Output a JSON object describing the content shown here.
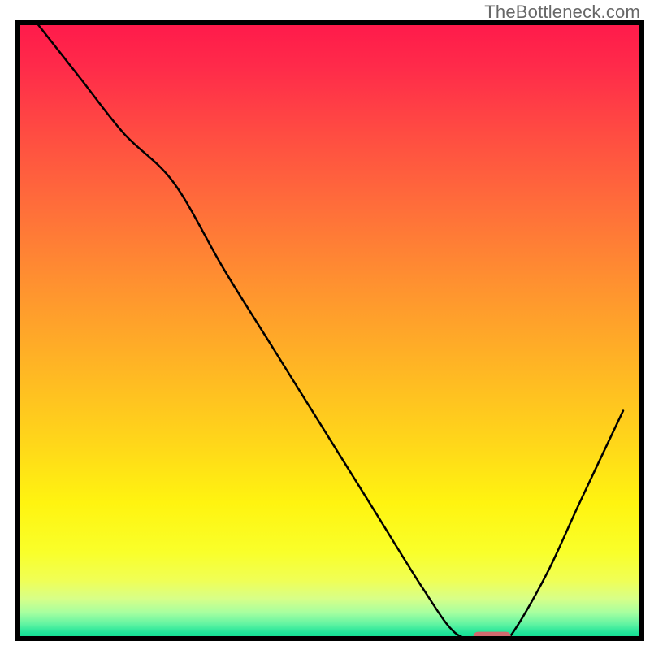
{
  "watermark": "TheBottleneck.com",
  "chart_data": {
    "type": "line",
    "title": "",
    "xlabel": "",
    "ylabel": "",
    "xlim": [
      0,
      100
    ],
    "ylim": [
      0,
      100
    ],
    "series": [
      {
        "name": "curve",
        "x": [
          3,
          10,
          17,
          25,
          33,
          41,
          49,
          57,
          65,
          70,
          74,
          78,
          80,
          85,
          90,
          97
        ],
        "y": [
          100,
          91,
          82,
          74,
          60,
          47,
          34,
          21,
          8,
          1,
          0,
          0,
          2,
          11,
          22,
          37
        ]
      }
    ],
    "marker": {
      "x_center": 76,
      "y_center": 0.4,
      "width": 6,
      "height": 1.4,
      "color": "#d16a6f"
    },
    "gradient_stops": [
      {
        "offset": 0.0,
        "color": "#ff1a4b"
      },
      {
        "offset": 0.07,
        "color": "#ff2a4a"
      },
      {
        "offset": 0.18,
        "color": "#ff4c42"
      },
      {
        "offset": 0.3,
        "color": "#ff6e3a"
      },
      {
        "offset": 0.42,
        "color": "#ff9030"
      },
      {
        "offset": 0.55,
        "color": "#ffb325"
      },
      {
        "offset": 0.68,
        "color": "#ffd61a"
      },
      {
        "offset": 0.78,
        "color": "#fff410"
      },
      {
        "offset": 0.86,
        "color": "#f9ff2a"
      },
      {
        "offset": 0.905,
        "color": "#f0ff55"
      },
      {
        "offset": 0.935,
        "color": "#d8ff88"
      },
      {
        "offset": 0.958,
        "color": "#a6ffa0"
      },
      {
        "offset": 0.976,
        "color": "#63f4a2"
      },
      {
        "offset": 0.99,
        "color": "#22e59a"
      },
      {
        "offset": 1.0,
        "color": "#0edb90"
      }
    ],
    "border_color": "#000000",
    "curve_color": "#000000",
    "curve_width": 2.5
  }
}
